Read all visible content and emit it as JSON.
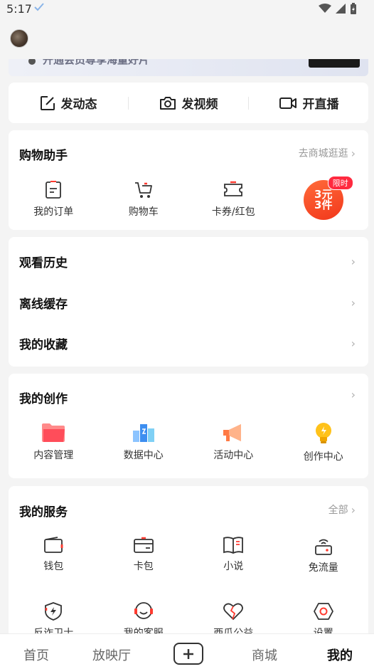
{
  "status_bar": {
    "time": "5:17"
  },
  "banner": {
    "text": "开通会员尊享海量好片"
  },
  "post_actions": [
    {
      "label": "发动态",
      "icon": "edit-icon"
    },
    {
      "label": "发视频",
      "icon": "camera-icon"
    },
    {
      "label": "开直播",
      "icon": "video-camera-icon"
    }
  ],
  "shopping": {
    "title": "购物助手",
    "link": "去商城逛逛",
    "items": [
      {
        "label": "我的订单",
        "icon": "order-icon"
      },
      {
        "label": "购物车",
        "icon": "cart-icon"
      },
      {
        "label": "卡券/红包",
        "icon": "coupon-icon"
      }
    ],
    "promo": {
      "line1": "3元",
      "line2": "3件",
      "tag": "限时"
    }
  },
  "list": [
    {
      "label": "观看历史"
    },
    {
      "label": "离线缓存"
    },
    {
      "label": "我的收藏"
    }
  ],
  "creation": {
    "title": "我的创作",
    "items": [
      {
        "label": "内容管理",
        "icon": "folder-icon"
      },
      {
        "label": "数据中心",
        "icon": "data-chart-icon"
      },
      {
        "label": "活动中心",
        "icon": "megaphone-icon"
      },
      {
        "label": "创作中心",
        "icon": "lightbulb-icon"
      }
    ]
  },
  "services": {
    "title": "我的服务",
    "link": "全部",
    "row1": [
      {
        "label": "钱包",
        "icon": "wallet-icon"
      },
      {
        "label": "卡包",
        "icon": "card-icon"
      },
      {
        "label": "小说",
        "icon": "book-icon"
      },
      {
        "label": "免流量",
        "icon": "free-data-icon"
      }
    ],
    "row2": [
      {
        "label": "反诈卫士",
        "icon": "shield-icon"
      },
      {
        "label": "我的客服",
        "icon": "headset-icon"
      },
      {
        "label": "西瓜公益",
        "icon": "charity-heart-icon"
      },
      {
        "label": "设置",
        "icon": "settings-icon"
      }
    ]
  },
  "tabbar": {
    "tabs": [
      {
        "label": "首页"
      },
      {
        "label": "放映厅"
      },
      {
        "label": "商城"
      },
      {
        "label": "我的"
      }
    ],
    "active": "我的"
  },
  "colors": {
    "accent": "#f2381b",
    "tag": "#ff2a3f",
    "blue": "#3d8ef0",
    "yellow": "#f6b400"
  }
}
